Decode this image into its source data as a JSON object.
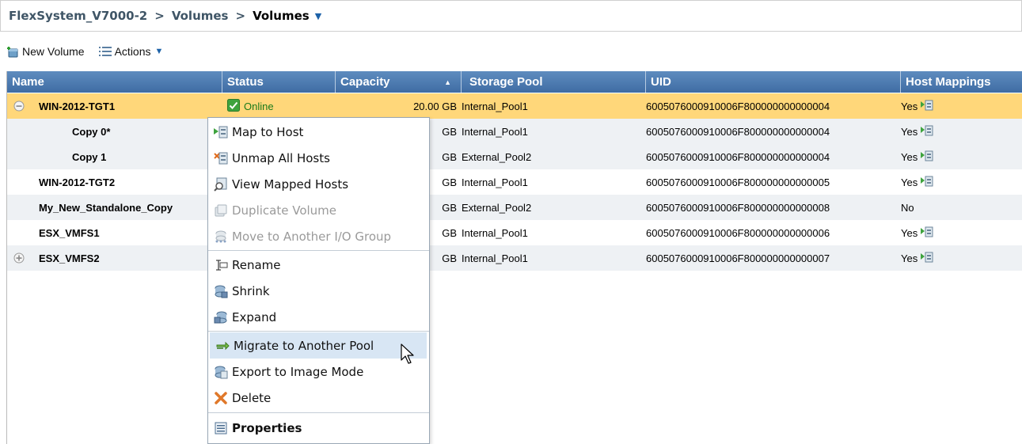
{
  "breadcrumb": {
    "system": "FlexSystem_V7000-2",
    "section": "Volumes",
    "current": "Volumes",
    "separator": ">"
  },
  "toolbar": {
    "new_volume": "New Volume",
    "actions": "Actions"
  },
  "columns": {
    "name": "Name",
    "status": "Status",
    "capacity": "Capacity",
    "pool": "Storage Pool",
    "uid": "UID",
    "host": "Host Mappings"
  },
  "rows": [
    {
      "name": "WIN-2012-TGT1",
      "status": "Online",
      "capacity": "20.00 GB",
      "pool": "Internal_Pool1",
      "uid": "6005076000910006F800000000000004",
      "host": "Yes"
    },
    {
      "name": "Copy 0*",
      "capacity": "GB",
      "pool": "Internal_Pool1",
      "uid": "6005076000910006F800000000000004",
      "host": "Yes"
    },
    {
      "name": "Copy 1",
      "capacity": "GB",
      "pool": "External_Pool2",
      "uid": "6005076000910006F800000000000004",
      "host": "Yes"
    },
    {
      "name": "WIN-2012-TGT2",
      "capacity": "GB",
      "pool": "Internal_Pool1",
      "uid": "6005076000910006F800000000000005",
      "host": "Yes"
    },
    {
      "name": "My_New_Standalone_Copy",
      "capacity": "GB",
      "pool": "External_Pool2",
      "uid": "6005076000910006F800000000000008",
      "host": "No"
    },
    {
      "name": "ESX_VMFS1",
      "capacity": "GB",
      "pool": "Internal_Pool1",
      "uid": "6005076000910006F800000000000006",
      "host": "Yes"
    },
    {
      "name": "ESX_VMFS2",
      "capacity": "GB",
      "pool": "Internal_Pool1",
      "uid": "6005076000910006F800000000000007",
      "host": "Yes"
    }
  ],
  "menu": {
    "map_to_host": "Map to Host",
    "unmap_all": "Unmap All Hosts",
    "view_mapped": "View Mapped Hosts",
    "duplicate": "Duplicate Volume",
    "move_io": "Move to Another I/O Group",
    "rename": "Rename",
    "shrink": "Shrink",
    "expand": "Expand",
    "migrate": "Migrate to Another Pool",
    "export": "Export to Image Mode",
    "delete": "Delete",
    "properties": "Properties"
  },
  "colors": {
    "header_blue": "#4a78ad",
    "selected_row": "#ffd77a",
    "online_green": "#1a7a1a",
    "menu_hover": "#d8e6f4"
  }
}
